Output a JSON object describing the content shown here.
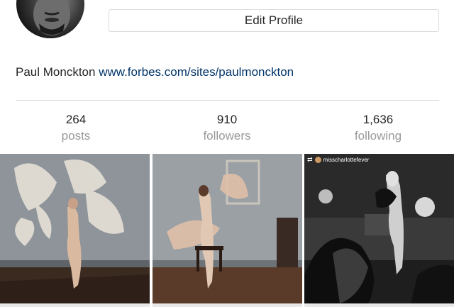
{
  "profile": {
    "edit_button_label": "Edit Profile",
    "name": "Paul Monckton",
    "website": "www.forbes.com/sites/paulmonckton"
  },
  "stats": [
    {
      "value": "264",
      "label": "posts"
    },
    {
      "value": "910",
      "label": "followers"
    },
    {
      "value": "1,636",
      "label": "following"
    }
  ],
  "posts": [
    {
      "repost_user": ""
    },
    {
      "repost_user": ""
    },
    {
      "repost_user": "misscharlottefever"
    }
  ],
  "colors": {
    "link": "#003569",
    "muted": "#999999",
    "border": "#dbdbdb"
  }
}
